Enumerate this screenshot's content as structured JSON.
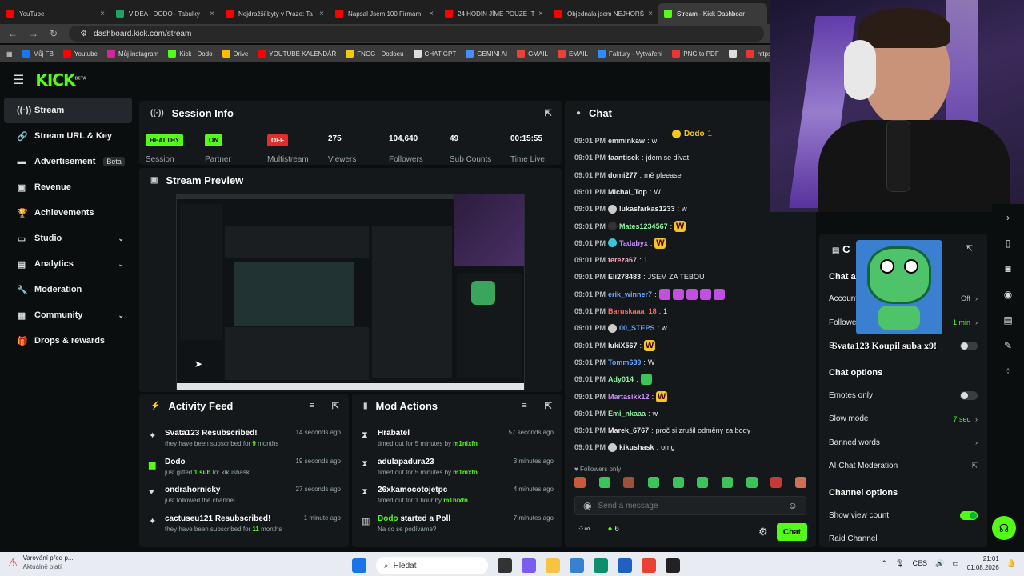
{
  "browser": {
    "tabs": [
      {
        "title": "YouTube",
        "color": "#ff0000"
      },
      {
        "title": "VIDEA - DODO - Tabulky",
        "color": "#1fa463"
      },
      {
        "title": "Nejdražší byty v Praze: Ta",
        "color": "#ff0000"
      },
      {
        "title": "Napsal Jsem 100 Firmám",
        "color": "#ff0000"
      },
      {
        "title": "24 HODIN JÍME POUZE IT",
        "color": "#ff0000"
      },
      {
        "title": "Objednala jsem NEJHORŠ",
        "color": "#ff0000"
      },
      {
        "title": "Stream - Kick Dashboar",
        "color": "#53fc18"
      }
    ],
    "url": "dashboard.kick.com/stream",
    "bookmarks": [
      "Můj FB",
      "Youtube",
      "Můj instagram",
      "Kick - Dodo",
      "Drive",
      "YOUTUBE KALENDÁŘ",
      "FNGG - Dodoeu",
      "CHAT GPT",
      "GEMINI AI",
      "GMAIL",
      "EMAIL",
      "Faktury - Vytváření",
      "PNG to PDF",
      "",
      "https://w"
    ]
  },
  "logo": {
    "text": "KICK",
    "sup": "BETA"
  },
  "sidebar": {
    "items": [
      {
        "label": "Stream",
        "icon": "broadcast-icon",
        "glyph": "((·))"
      },
      {
        "label": "Stream URL & Key",
        "icon": "link-icon",
        "glyph": "🔗"
      },
      {
        "label": "Advertisement",
        "icon": "ad-icon",
        "glyph": "▬",
        "badge": "Beta"
      },
      {
        "label": "Revenue",
        "icon": "revenue-icon",
        "glyph": "▣"
      },
      {
        "label": "Achievements",
        "icon": "trophy-icon",
        "glyph": "🏆"
      },
      {
        "label": "Studio",
        "icon": "studio-icon",
        "glyph": "▭"
      },
      {
        "label": "Analytics",
        "icon": "analytics-icon",
        "glyph": "▤"
      },
      {
        "label": "Moderation",
        "icon": "wrench-icon",
        "glyph": "🔧"
      },
      {
        "label": "Community",
        "icon": "community-icon",
        "glyph": "▦"
      },
      {
        "label": "Drops & rewards",
        "icon": "gift-icon",
        "glyph": "🎁"
      }
    ]
  },
  "session": {
    "title": "Session Info",
    "stats": [
      {
        "value": "HEALTHY",
        "label": "Session"
      },
      {
        "value": "ON",
        "label": "Partner"
      },
      {
        "value": "OFF",
        "label": "Multistream"
      },
      {
        "value": "275",
        "label": "Viewers"
      },
      {
        "value": "104,640",
        "label": "Followers"
      },
      {
        "value": "49",
        "label": "Sub Counts"
      },
      {
        "value": "00:15:55",
        "label": "Time Live"
      }
    ]
  },
  "preview": {
    "title": "Stream Preview"
  },
  "activity": {
    "title": "Activity Feed",
    "rows": [
      {
        "title": "Svata123 Resubscribed!",
        "sub_a": "they have been subscribed for ",
        "sub_b": "9",
        "sub_c": " months",
        "ago": "14 seconds ago"
      },
      {
        "title": "Dodo",
        "sub_a": "just gifted ",
        "sub_b": "1 sub",
        "sub_c": " to: kikushask",
        "ago": "19 seconds ago"
      },
      {
        "title": "ondrahornicky",
        "sub_a": "just followed the channel",
        "sub_b": "",
        "sub_c": "",
        "ago": "27 seconds ago"
      },
      {
        "title": "cactuseu121 Resubscribed!",
        "sub_a": "they have been subscribed for ",
        "sub_b": "11",
        "sub_c": " months",
        "ago": "1 minute ago"
      }
    ]
  },
  "mod": {
    "title": "Mod Actions",
    "rows": [
      {
        "title": "Hrabatel",
        "sub_a": "timed out for 5 minutes by ",
        "sub_b": "m1nixfn",
        "ago": "57 seconds ago"
      },
      {
        "title": "adulapadura23",
        "sub_a": "timed out for 5 minutes by ",
        "sub_b": "m1nixfn",
        "ago": "3 minutes ago"
      },
      {
        "title": "26xkamocotojetpc",
        "sub_a": "timed out for 1 hour by ",
        "sub_b": "m1nixfn",
        "ago": "4 minutes ago"
      },
      {
        "title": "Dodo",
        "title_b": " started a Poll",
        "sub_a": "Na co se podíváme?",
        "sub_b": "",
        "ago": "7 minutes ago"
      }
    ]
  },
  "chat": {
    "title": "Chat",
    "pinned": "Dodo",
    "pinned_count": "1",
    "messages": [
      {
        "time": "09:01 PM",
        "user": "emminkaw",
        "color": "#dddddd",
        "text": "w"
      },
      {
        "time": "09:01 PM",
        "user": "faantisek",
        "color": "#e8e8e8",
        "text": "jdem se dívat"
      },
      {
        "time": "09:01 PM",
        "user": "domi277",
        "color": "#e8e8e8",
        "text": "mě pleease"
      },
      {
        "time": "09:01 PM",
        "user": "Michal_Top",
        "color": "#e8e8e8",
        "text": "W"
      },
      {
        "time": "09:01 PM",
        "user": "lukasfarkas1233",
        "color": "#e8e8e8",
        "text": "w"
      },
      {
        "time": "09:01 PM",
        "user": "Mates1234567",
        "color": "#8ef3a0",
        "text": "W"
      },
      {
        "time": "09:01 PM",
        "user": "Tadabyx",
        "color": "#c88cff",
        "text": "W"
      },
      {
        "time": "09:01 PM",
        "user": "tereza67",
        "color": "#f4a6b8",
        "text": "1"
      },
      {
        "time": "09:01 PM",
        "user": "Eli278483",
        "color": "#e8e8e8",
        "text": "JSEM ZA TEBOU"
      },
      {
        "time": "09:01 PM",
        "user": "erik_winner7",
        "color": "#6aa8ff",
        "text": ""
      },
      {
        "time": "09:01 PM",
        "user": "Baruskaaa_18",
        "color": "#ff6b6b",
        "text": "1"
      },
      {
        "time": "09:01 PM",
        "user": "00_STEPS",
        "color": "#6aa8ff",
        "text": "w"
      },
      {
        "time": "09:01 PM",
        "user": "lukiX567",
        "color": "#e8e8e8",
        "text": "W"
      },
      {
        "time": "09:01 PM",
        "user": "Tomm689",
        "color": "#6aa8ff",
        "text": "W"
      },
      {
        "time": "09:01 PM",
        "user": "Ady014",
        "color": "#8ef3a0",
        "text": ""
      },
      {
        "time": "09:01 PM",
        "user": "Martasikk12",
        "color": "#c88cff",
        "text": "W"
      },
      {
        "time": "09:01 PM",
        "user": "Emi_nkaaa",
        "color": "#8ef3a0",
        "text": "w"
      },
      {
        "time": "09:01 PM",
        "user": "Marek_6767",
        "color": "#e8e8e8",
        "text": "proč si zrušil odměny za body"
      },
      {
        "time": "09:01 PM",
        "user": "kikushask",
        "color": "#e8e8e8",
        "text": "omg"
      }
    ],
    "followers_only": "Followers only",
    "placeholder": "Send a message",
    "viewer_count": "6",
    "send_label": "Chat"
  },
  "settings": {
    "header_title": "C",
    "chat_actions_title": "Chat ac",
    "account_label": "Account",
    "account_value": "Off",
    "follower_label": "Follower",
    "follower_value": "1 min",
    "sub_label": "S",
    "alert_text": "Svata123 Koupil suba x9!",
    "chat_options_title": "Chat options",
    "rows": [
      {
        "label": "Emotes only",
        "value": "",
        "toggle": "off"
      },
      {
        "label": "Slow mode",
        "value": "7 sec",
        "toggle": "none"
      },
      {
        "label": "Banned words",
        "value": "",
        "toggle": "none"
      },
      {
        "label": "AI Chat Moderation",
        "value": "",
        "toggle": "none"
      }
    ],
    "channel_options_title": "Channel options",
    "channel_rows": [
      {
        "label": "Show view count",
        "toggle": "on"
      },
      {
        "label": "Raid Channel",
        "toggle": "none"
      }
    ]
  },
  "taskbar": {
    "notif_title": "Varování před p...",
    "notif_sub": "Aktuálně platí",
    "search_placeholder": "Hledat",
    "lang": "CES",
    "time": "21:01",
    "date": "01.08.2026"
  },
  "colors": {
    "accent": "#53fc18",
    "off": "#e32d2d"
  }
}
